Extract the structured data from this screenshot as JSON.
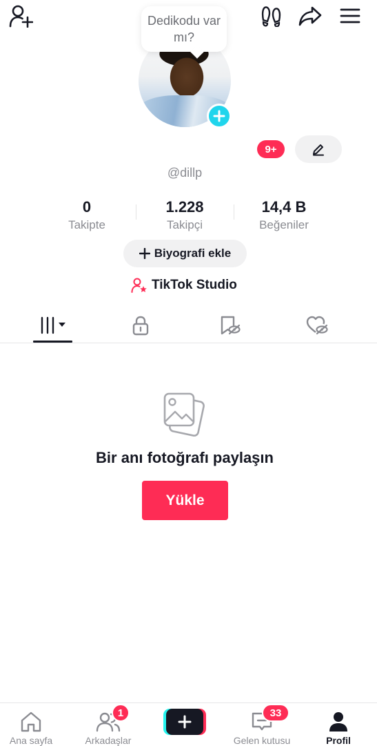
{
  "header": {
    "gossip_bubble": "Dedikodu var mı?"
  },
  "profile": {
    "username": "@dillp",
    "notification_badge": "9+"
  },
  "stats": [
    {
      "value": "0",
      "label": "Takipte"
    },
    {
      "value": "1.228",
      "label": "Takipçi"
    },
    {
      "value": "14,4 B",
      "label": "Beğeniler"
    }
  ],
  "actions": {
    "bio_label": "Biyografi ekle",
    "studio_label": "TikTok Studio"
  },
  "empty_state": {
    "title": "Bir anı fotoğrafı paylaşın",
    "button_label": "Yükle"
  },
  "bottom_nav": {
    "items": [
      {
        "label": "Ana sayfa"
      },
      {
        "label": "Arkadaşlar",
        "badge": "1"
      },
      {
        "label": "Gelen kutusu",
        "badge": "33"
      },
      {
        "label": "Profil"
      }
    ]
  },
  "colors": {
    "accent": "#fe2c55",
    "avatar_plus": "#20d5ec",
    "text_primary": "#161823",
    "text_secondary": "#8a8b91"
  },
  "icons": {
    "top_left": "add-friend-icon",
    "top_right": [
      "footprint-icon",
      "share-icon",
      "menu-icon"
    ],
    "tabs": [
      "grid-icon",
      "lock-icon",
      "favorites-icon",
      "liked-icon"
    ]
  }
}
